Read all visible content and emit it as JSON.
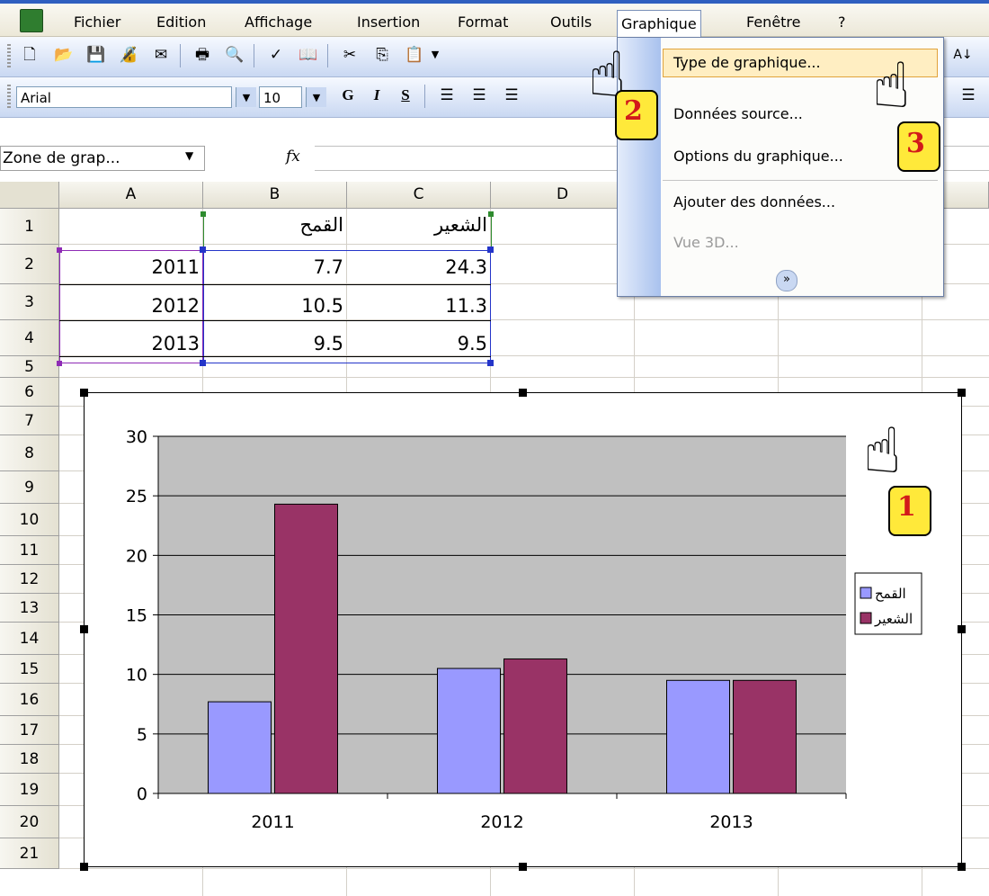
{
  "menubar": {
    "items": [
      "Fichier",
      "Edition",
      "Affichage",
      "Insertion",
      "Format",
      "Outils",
      "Graphique",
      "Fenêtre",
      "?"
    ]
  },
  "toolbar_format": {
    "font_name": "Arial",
    "font_size": "10",
    "bold_label": "G",
    "italic_label": "I",
    "underline_label": "S"
  },
  "formula_bar": {
    "name_box": "Zone de grap...",
    "fx_label": "fx"
  },
  "dropdown": {
    "items": [
      {
        "label": "Type de graphique...",
        "enabled": true,
        "highlighted": true
      },
      {
        "label": "Données source...",
        "enabled": true
      },
      {
        "label": "Options du graphique...",
        "enabled": true
      },
      {
        "label": "Ajouter des données...",
        "enabled": true
      },
      {
        "label": "Vue 3D...",
        "enabled": false
      }
    ],
    "expand_label": "»"
  },
  "sheet": {
    "columns": [
      "A",
      "B",
      "C",
      "D"
    ],
    "rows": [
      "1",
      "2",
      "3",
      "4",
      "5",
      "6",
      "7",
      "8",
      "9",
      "10",
      "11",
      "12",
      "13",
      "14",
      "15",
      "16",
      "17",
      "18",
      "19",
      "20",
      "21"
    ],
    "cells": {
      "B1": "القمح",
      "C1": "الشعير",
      "A2": "2011",
      "B2": "7.7",
      "C2": "24.3",
      "A3": "2012",
      "B3": "10.5",
      "C3": "11.3",
      "A4": "2013",
      "B4": "9.5",
      "C4": "9.5"
    }
  },
  "annotations": {
    "step1": "1",
    "step2": "2",
    "step3": "3"
  },
  "chart_data": {
    "type": "bar",
    "categories": [
      "2011",
      "2012",
      "2013"
    ],
    "series": [
      {
        "name": "القمح",
        "values": [
          7.7,
          10.5,
          9.5
        ],
        "color": "#9999ff"
      },
      {
        "name": "الشعير",
        "values": [
          24.3,
          11.3,
          9.5
        ],
        "color": "#993366"
      }
    ],
    "yticks": [
      0,
      5,
      10,
      15,
      20,
      25,
      30
    ],
    "ylim": [
      0,
      30
    ],
    "plot_background": "#c0c0c0",
    "grid": true,
    "legend": "right"
  }
}
